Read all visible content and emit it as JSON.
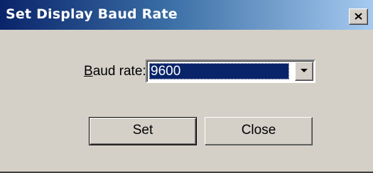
{
  "window": {
    "title": "Set Display Baud Rate"
  },
  "titlebar_buttons": {
    "close_icon": "close-x-icon"
  },
  "form": {
    "baud_label_mnemonic": "B",
    "baud_label_rest": "aud rate:",
    "baud_value": "9600",
    "dropdown_icon": "chevron-down-icon"
  },
  "buttons": {
    "set_label": "Set",
    "close_label": "Close"
  },
  "colors": {
    "titlebar_start": "#0a246a",
    "titlebar_end": "#a6caf0",
    "selection": "#0a246a",
    "face": "#d4d0c8"
  }
}
